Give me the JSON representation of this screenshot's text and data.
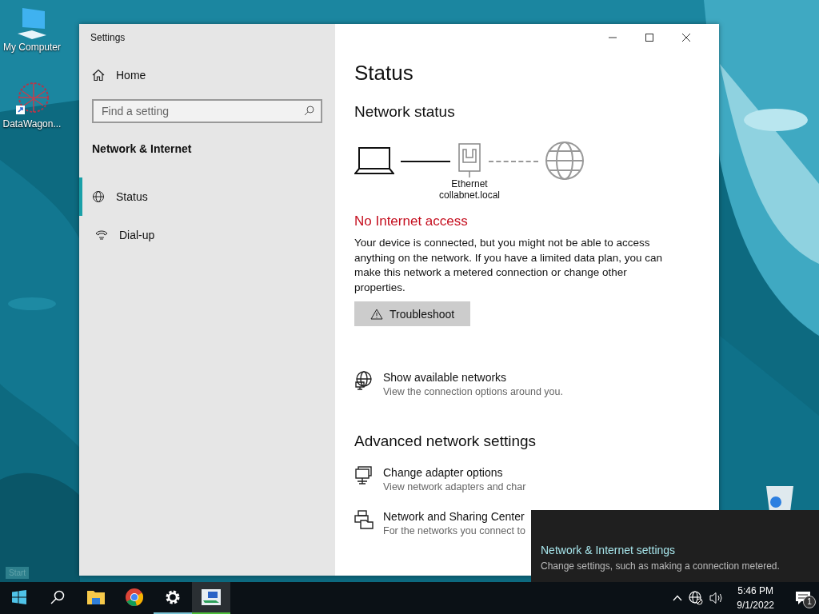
{
  "desktop_icons": [
    {
      "kind": "computer",
      "label": "My Computer"
    },
    {
      "kind": "shortcut",
      "label": "DataWagon..."
    },
    {
      "kind": "bin"
    }
  ],
  "start_tooltip": "Start",
  "window": {
    "title": "Settings",
    "sidebar": {
      "home": "Home",
      "search": {
        "placeholder": "Find a setting"
      },
      "section": "Network & Internet",
      "items": [
        {
          "kind": "globe",
          "label": "Status",
          "selected": true
        },
        {
          "kind": "phone",
          "label": "Dial-up",
          "selected": false
        }
      ]
    },
    "content": {
      "title": "Status",
      "subtitle": "Network status",
      "adapter": {
        "name": "Ethernet",
        "network": "collabnet.local",
        "internet_connected": false
      },
      "alert": "No Internet access",
      "description": "Your device is connected, but you might not be able to access anything on the network. If you have a limited data plan, you can make this network a metered connection or change other properties.",
      "button": "Troubleshoot",
      "links": [
        {
          "kind": "globe",
          "title": "Show available networks",
          "subtitle": "View the connection options around you."
        }
      ],
      "advanced_title": "Advanced network settings",
      "advanced_links": [
        {
          "kind": "monitor",
          "title": "Change adapter options",
          "subtitle": "View network adapters and char"
        },
        {
          "kind": "printer",
          "title": "Network and Sharing Center",
          "subtitle": "For the networks you connect to"
        }
      ]
    }
  },
  "flyout": {
    "title": "Network & Internet settings",
    "subtitle": "Change settings, such as making a connection metered."
  },
  "taskbar": {
    "apps": [
      {
        "kind": "start",
        "running": false,
        "selected": false
      },
      {
        "kind": "search",
        "running": false,
        "selected": false
      },
      {
        "kind": "folder",
        "running": false,
        "selected": false
      },
      {
        "kind": "browser",
        "running": false,
        "selected": false
      },
      {
        "kind": "gear",
        "running": true,
        "selected": false
      },
      {
        "kind": "network-app",
        "running": true,
        "selected": true
      }
    ],
    "time": "5:46 PM",
    "date": "9/1/2022",
    "notifications": "1"
  }
}
